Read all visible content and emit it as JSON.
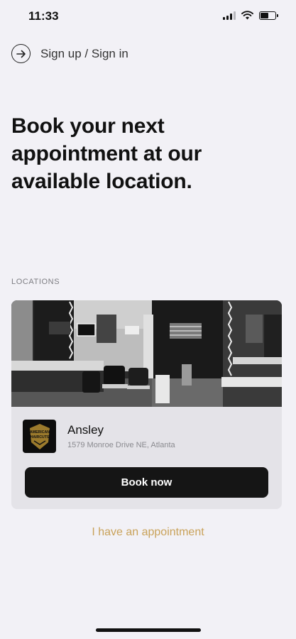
{
  "status_bar": {
    "time": "11:33"
  },
  "auth": {
    "signin_label": "Sign up / Sign in"
  },
  "headline": "Book your next appointment at our available location.",
  "section_label": "LOCATIONS",
  "location": {
    "name": "Ansley",
    "address": "1579 Monroe Drive NE, Atlanta",
    "book_label": "Book now",
    "logo_text_top": "AMERICAN",
    "logo_text_bottom": "HAIRCUTS"
  },
  "appointment_link": "I have an appointment"
}
